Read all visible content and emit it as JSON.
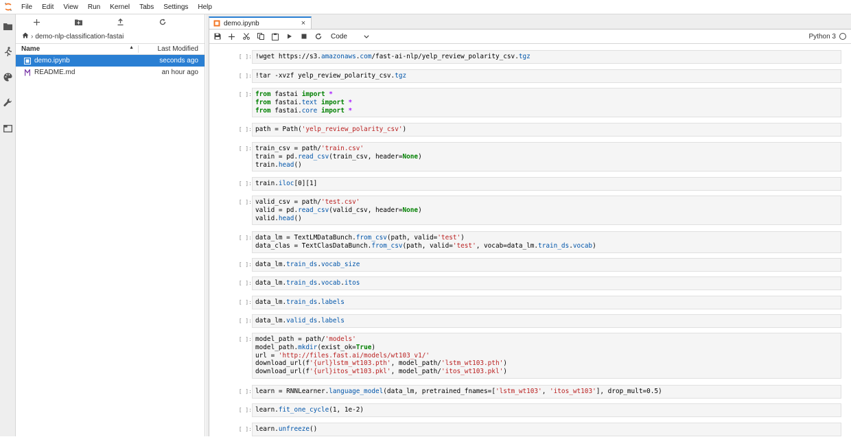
{
  "menu": [
    "File",
    "Edit",
    "View",
    "Run",
    "Kernel",
    "Tabs",
    "Settings",
    "Help"
  ],
  "filebrowser": {
    "breadcrumb": "demo-nlp-classification-fastai",
    "col_name": "Name",
    "col_modified": "Last Modified",
    "files": [
      {
        "name": "demo.ipynb",
        "modified": "seconds ago",
        "icon": "notebook-icon",
        "selected": true
      },
      {
        "name": "README.md",
        "modified": "an hour ago",
        "icon": "markdown-icon",
        "selected": false
      }
    ]
  },
  "tab": {
    "label": "demo.ipynb",
    "close": "×"
  },
  "toolbar": {
    "cell_type": "Code",
    "kernel": "Python 3"
  },
  "cells": [
    {
      "prompt": "[ ]:",
      "lines": [
        "!wget https://s3.amazonaws.com/fast-ai-nlp/yelp_review_polarity_csv.tgz"
      ]
    },
    {
      "prompt": "[ ]:",
      "lines": [
        "!tar -xvzf yelp_review_polarity_csv.tgz"
      ]
    },
    {
      "prompt": "[ ]:",
      "lines": [
        "from fastai import *",
        "from fastai.text import *",
        "from fastai.core import *"
      ]
    },
    {
      "prompt": "[ ]:",
      "lines": [
        "path = Path('yelp_review_polarity_csv')"
      ]
    },
    {
      "prompt": "[ ]:",
      "lines": [
        "train_csv = path/'train.csv'",
        "train = pd.read_csv(train_csv, header=None)",
        "train.head()"
      ]
    },
    {
      "prompt": "[ ]:",
      "lines": [
        "train.iloc[0][1]"
      ]
    },
    {
      "prompt": "[ ]:",
      "lines": [
        "valid_csv = path/'test.csv'",
        "valid = pd.read_csv(valid_csv, header=None)",
        "valid.head()"
      ]
    },
    {
      "prompt": "[ ]:",
      "lines": [
        "data_lm = TextLMDataBunch.from_csv(path, valid='test')",
        "data_clas = TextClasDataBunch.from_csv(path, valid='test', vocab=data_lm.train_ds.vocab)"
      ]
    },
    {
      "prompt": "[ ]:",
      "lines": [
        "data_lm.train_ds.vocab_size"
      ]
    },
    {
      "prompt": "[ ]:",
      "lines": [
        "data_lm.train_ds.vocab.itos"
      ]
    },
    {
      "prompt": "[ ]:",
      "lines": [
        "data_lm.train_ds.labels"
      ]
    },
    {
      "prompt": "[ ]:",
      "lines": [
        "data_lm.valid_ds.labels"
      ]
    },
    {
      "prompt": "[ ]:",
      "lines": [
        "model_path = path/'models'",
        "model_path.mkdir(exist_ok=True)",
        "url = 'http://files.fast.ai/models/wt103_v1/'",
        "download_url(f'{url}lstm_wt103.pth', model_path/'lstm_wt103.pth')",
        "download_url(f'{url}itos_wt103.pkl', model_path/'itos_wt103.pkl')"
      ]
    },
    {
      "prompt": "[ ]:",
      "lines": [
        "learn = RNNLearner.language_model(data_lm, pretrained_fnames=['lstm_wt103', 'itos_wt103'], drop_mult=0.5)"
      ]
    },
    {
      "prompt": "[ ]:",
      "lines": [
        "learn.fit_one_cycle(1, 1e-2)"
      ]
    },
    {
      "prompt": "[ ]:",
      "lines": [
        "learn.unfreeze()"
      ]
    }
  ],
  "colors": {
    "accent": "#2a7fd3",
    "keyword": "#008000",
    "string": "#ba2121",
    "attribute": "#0055aa"
  }
}
